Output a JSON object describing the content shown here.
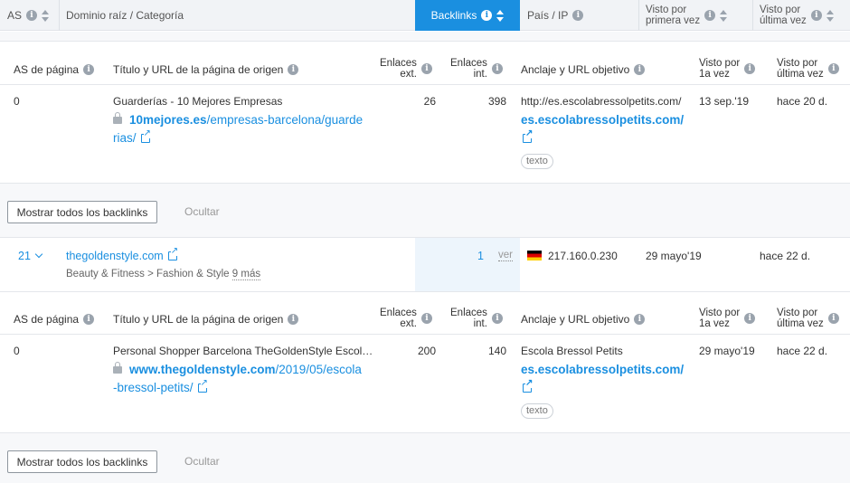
{
  "header": {
    "as": "AS",
    "domain_category": "Dominio raíz / Categoría",
    "backlinks": "Backlinks",
    "country_ip": "País / IP",
    "first_seen_1": "Visto por",
    "first_seen_2": "primera vez",
    "last_seen_1": "Visto por",
    "last_seen_2": "última vez"
  },
  "detail_headers": {
    "page_as": "AS de página",
    "title_url": "Título y URL de la página de origen",
    "ext_1": "Enlaces",
    "ext_2": "ext.",
    "int_1": "Enlaces",
    "int_2": "int.",
    "anchor": "Anclaje y URL objetivo",
    "first_1": "Visto por",
    "first_2": "1a vez",
    "last_1": "Visto por",
    "last_2": "última vez"
  },
  "backlinks": [
    {
      "page_as": "0",
      "title": "Guarderías - 10 Mejores Empresas",
      "url_domain": "10mejores.es",
      "url_path_1": "/empresas-barcelona/guarde",
      "url_path_2": "rias/",
      "ext": "26",
      "int": "398",
      "anchor": "http://es.escolabressolpetits.com/",
      "target": "es.escolabressolpetits.com/",
      "tag": "texto",
      "first_seen": "13 sep.'19",
      "last_seen": "hace 20 d."
    },
    {
      "page_as": "0",
      "title": "Personal Shopper Barcelona TheGoldenStyle Escol…",
      "url_domain": "www.thegoldenstyle.com",
      "url_path_1": "/2019/05/escola",
      "url_path_2": "-bressol-petits/",
      "ext": "200",
      "int": "140",
      "anchor": "Escola Bressol Petits",
      "target": "es.escolabressolpetits.com/",
      "tag": "texto",
      "first_seen": "29 mayo'19",
      "last_seen": "hace 22 d."
    }
  ],
  "domain_row": {
    "as": "21",
    "domain": "thegoldenstyle.com",
    "category": "Beauty & Fitness > Fashion & Style",
    "more": "9 más",
    "backlinks": "1",
    "view": "ver",
    "ip": "217.160.0.230",
    "first_seen": "29 mayo'19",
    "last_seen": "hace 22 d."
  },
  "actions": {
    "show_all": "Mostrar todos los backlinks",
    "hide": "Ocultar"
  },
  "colors": {
    "accent": "#1a8fe0",
    "header_bg": "#f1f3f6",
    "band_bg": "#f7f8fa"
  }
}
